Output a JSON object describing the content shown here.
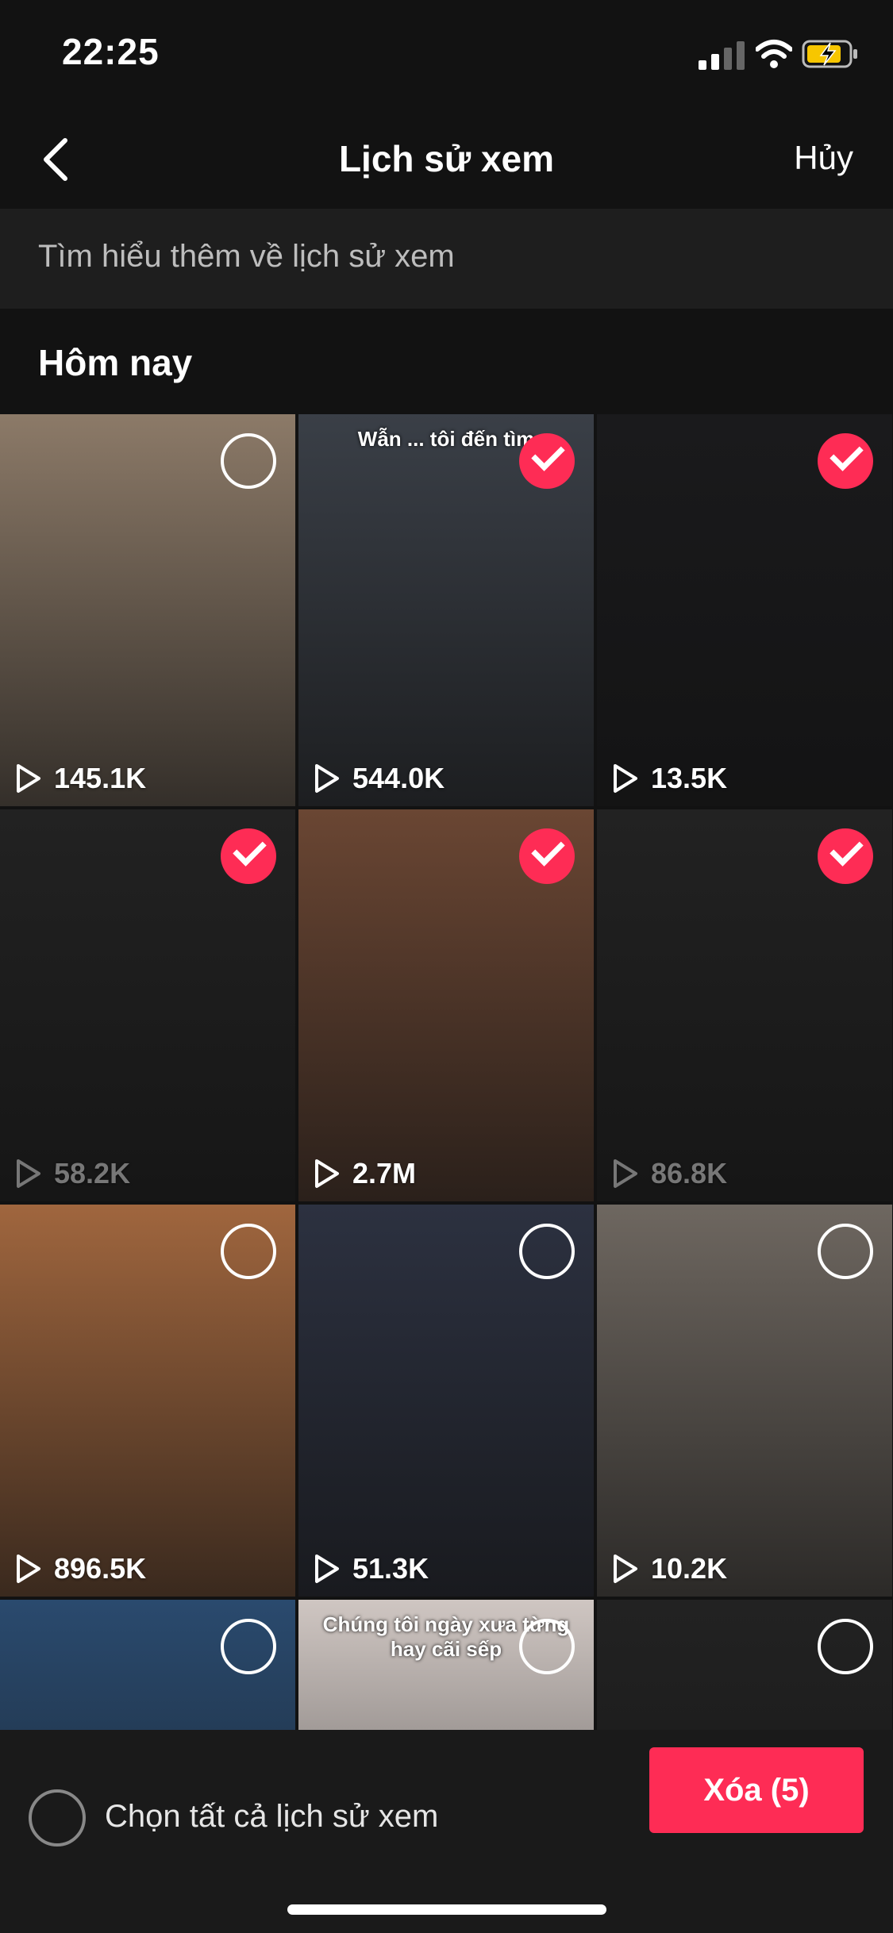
{
  "status_bar": {
    "time": "22:25",
    "battery": "charging"
  },
  "header": {
    "back_icon": "chevron-left-icon",
    "title": "Lịch sử xem",
    "cancel_label": "Hủy"
  },
  "learn_more": "Tìm hiểu thêm về lịch sử xem",
  "section_title": "Hôm nay",
  "videos": [
    {
      "views": "145.1K",
      "selected": false,
      "color": "#8c7a68"
    },
    {
      "views": "544.0K",
      "selected": true,
      "color": "#3a3f47",
      "caption": "Wẫn ... tôi đến tìm"
    },
    {
      "views": "13.5K",
      "selected": true,
      "color": "#1a1a1c"
    },
    {
      "views": "58.2K",
      "selected": true,
      "color": "#222222"
    },
    {
      "views": "2.7M",
      "selected": true,
      "color": "#6a4633"
    },
    {
      "views": "86.8K",
      "selected": true,
      "color": "#222222"
    },
    {
      "views": "896.5K",
      "selected": false,
      "color": "#a0663e"
    },
    {
      "views": "51.3K",
      "selected": false,
      "color": "#2c3140"
    },
    {
      "views": "10.2K",
      "selected": false,
      "color": "#6e6760"
    },
    {
      "views": "",
      "selected": false,
      "color": "#2a4a6e"
    },
    {
      "views": "",
      "selected": false,
      "color": "#cfc6c2",
      "caption": "Chúng tôi ngày xưa từng hay cãi sếp"
    },
    {
      "views": "",
      "selected": false,
      "color": "#222222"
    }
  ],
  "bottom_bar": {
    "select_all_label": "Chọn tất cả lịch sử xem",
    "delete_label": "Xóa (5)"
  },
  "colors": {
    "accent": "#fe2c55",
    "background": "#121212"
  }
}
